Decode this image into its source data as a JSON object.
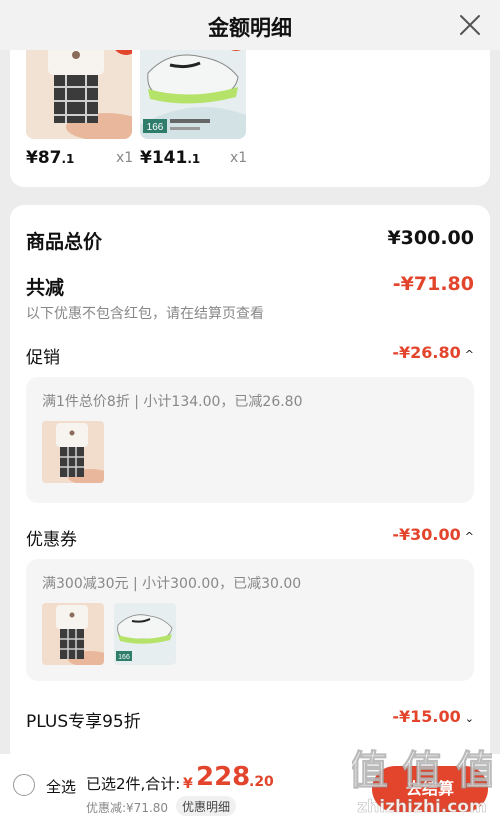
{
  "header": {
    "title": "金额明细"
  },
  "products": [
    {
      "price_int": "¥87",
      "price_dec": ".1",
      "qty": "x1"
    },
    {
      "price_int": "¥141",
      "price_dec": ".1",
      "qty": "x1",
      "badge": "166"
    }
  ],
  "summary": {
    "total_label": "商品总价",
    "total_value": "¥300.00",
    "reduce_label": "共减",
    "reduce_value": "-¥71.80",
    "note": "以下优惠不包含红包，请在结算页查看"
  },
  "promotion": {
    "label": "促销",
    "value": "-¥26.80",
    "caret": "^",
    "detail": "满1件总价8折 | 小计134.00，已减26.80"
  },
  "coupon": {
    "label": "优惠券",
    "value": "-¥30.00",
    "caret": "^",
    "detail": "满300减30元 | 小计300.00，已减30.00"
  },
  "plus": {
    "label": "PLUS专享95折",
    "value": "-¥15.00",
    "caret": "⌄"
  },
  "bottom": {
    "select_all": "全选",
    "selected_info": "已选2件,合计:",
    "currency": "¥",
    "total_int": "228",
    "total_dec": ".20",
    "discount_info": "优惠减:¥71.80",
    "detail_link": "优惠明细",
    "checkout": "去结算"
  },
  "watermark": {
    "text": "值 值 值",
    "url": "zhizhizhi.com"
  },
  "colors": {
    "accent": "#e2452c",
    "muted": "#888888",
    "background": "#ececec"
  }
}
